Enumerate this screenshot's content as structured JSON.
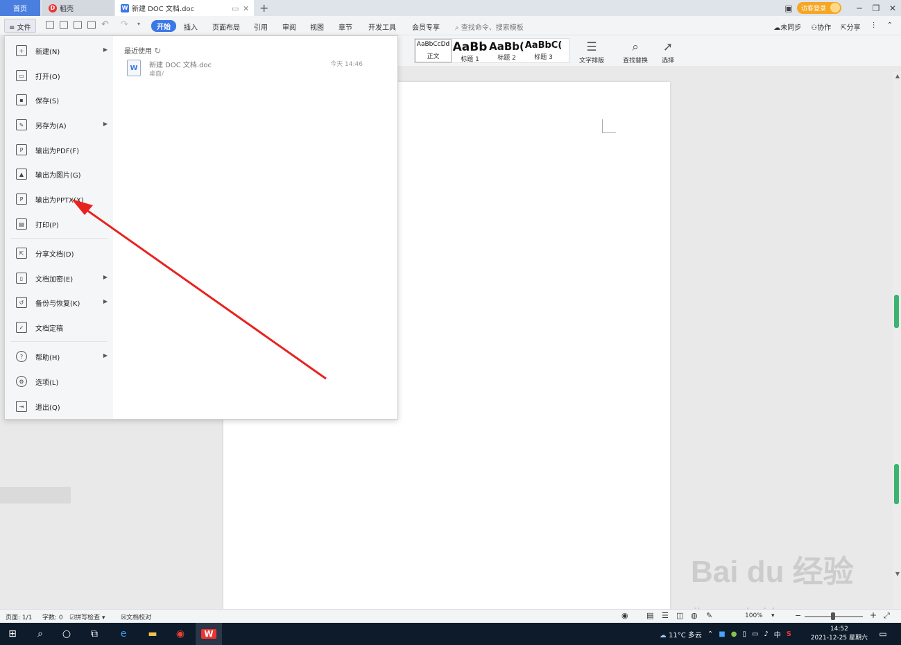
{
  "tabs": {
    "home": "首页",
    "daoke": "稻壳",
    "doc": "新建 DOC 文档.doc"
  },
  "window": {
    "login": "访客登录"
  },
  "menubar": {
    "file": "文件",
    "start": "开始",
    "items": [
      "插入",
      "页面布局",
      "引用",
      "审阅",
      "视图",
      "章节",
      "开发工具",
      "会员专享"
    ],
    "search": "查找命令、搜索模板",
    "sync": "未同步",
    "collab": "协作",
    "share": "分享"
  },
  "styles": [
    {
      "sample": "AaBbCcDd",
      "label": "正文"
    },
    {
      "sample": "AaBb",
      "label": "标题 1"
    },
    {
      "sample": "AaBb(",
      "label": "标题 2"
    },
    {
      "sample": "AaBbC(",
      "label": "标题 3"
    }
  ],
  "tools": {
    "text_layout": "文字排版",
    "find_replace": "查找替换",
    "select": "选择"
  },
  "file_menu": {
    "items": [
      {
        "label": "新建(N)",
        "arrow": true,
        "icon": "new-doc-icon"
      },
      {
        "label": "打开(O)",
        "arrow": false,
        "icon": "folder-icon"
      },
      {
        "label": "保存(S)",
        "arrow": false,
        "icon": "save-icon"
      },
      {
        "label": "另存为(A)",
        "arrow": true,
        "icon": "save-as-icon"
      },
      {
        "label": "输出为PDF(F)",
        "arrow": false,
        "icon": "pdf-icon"
      },
      {
        "label": "输出为图片(G)",
        "arrow": false,
        "icon": "image-icon"
      },
      {
        "label": "输出为PPTX(X)",
        "arrow": false,
        "icon": "pptx-icon"
      },
      {
        "label": "打印(P)",
        "arrow": false,
        "icon": "print-icon"
      },
      {
        "label": "分享文档(D)",
        "arrow": false,
        "icon": "share-icon"
      },
      {
        "label": "文档加密(E)",
        "arrow": true,
        "icon": "lock-icon"
      },
      {
        "label": "备份与恢复(K)",
        "arrow": true,
        "icon": "backup-icon"
      },
      {
        "label": "文档定稿",
        "arrow": false,
        "icon": "finalize-icon"
      },
      {
        "label": "帮助(H)",
        "arrow": true,
        "icon": "help-icon"
      },
      {
        "label": "选项(L)",
        "arrow": false,
        "icon": "gear-icon"
      },
      {
        "label": "退出(Q)",
        "arrow": false,
        "icon": "exit-icon"
      }
    ],
    "recent_title": "最近使用",
    "recent_file": {
      "name": "新建 DOC 文档.doc",
      "path": "桌面/",
      "time": "今天  14:46"
    }
  },
  "statusbar": {
    "page": "页面: 1/1",
    "words": "字数: 0",
    "spell": "拼写检查",
    "proof": "文档校对",
    "zoom": "100%"
  },
  "taskbar": {
    "weather": "11°C  多云",
    "ime": "中",
    "time": "14:52",
    "date": "2021-12-25 星期六"
  },
  "watermark": {
    "brand": "Bai du 经验",
    "url": "jingyan.baidu.com"
  },
  "colors": {
    "accent": "#3a78e7",
    "annotation": "#e8231f",
    "login": "#f5a623"
  }
}
